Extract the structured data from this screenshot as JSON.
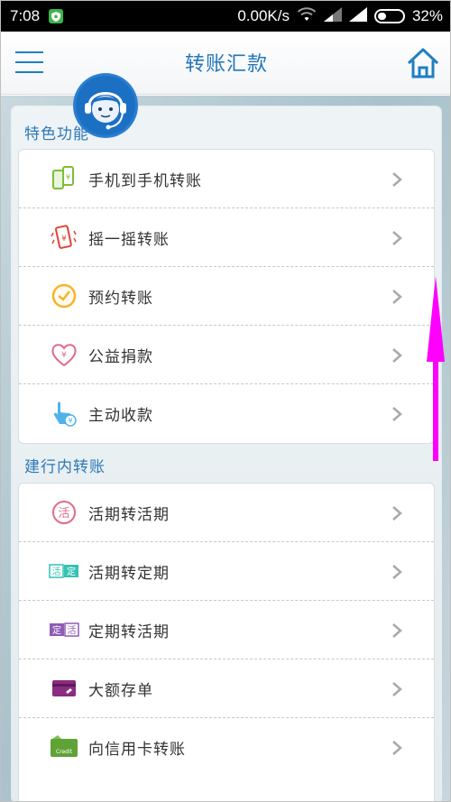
{
  "status_bar": {
    "time": "7:08",
    "net_speed": "0.00K/s",
    "battery": "32%"
  },
  "header": {
    "title": "转账汇款"
  },
  "sections": [
    {
      "title": "特色功能",
      "items": [
        {
          "label": "手机到手机转账",
          "icon": "phone-transfer-icon"
        },
        {
          "label": "摇一摇转账",
          "icon": "shake-phone-icon"
        },
        {
          "label": "预约转账",
          "icon": "clock-icon"
        },
        {
          "label": "公益捐款",
          "icon": "heart-yen-icon"
        },
        {
          "label": "主动收款",
          "icon": "hand-yen-icon"
        }
      ]
    },
    {
      "title": "建行内转账",
      "items": [
        {
          "label": "活期转活期",
          "icon": "huo-badge-icon",
          "badge": "活"
        },
        {
          "label": "活期转定期",
          "icon": "huo-ding-icon",
          "badge_a": "活",
          "badge_b": "定"
        },
        {
          "label": "定期转活期",
          "icon": "ding-huo-icon",
          "badge_a": "定",
          "badge_b": "活"
        },
        {
          "label": "大额存单",
          "icon": "certificate-card-icon"
        },
        {
          "label": "向信用卡转账",
          "icon": "credit-card-icon",
          "card_text": "Credit"
        }
      ]
    }
  ],
  "colors": {
    "accent": "#2376b9",
    "arrow": "#ff00ff"
  }
}
